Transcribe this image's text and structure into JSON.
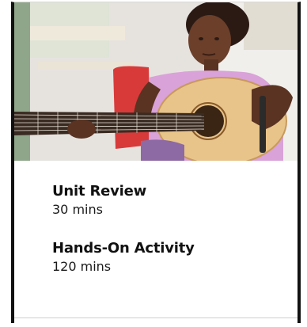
{
  "card": {
    "image": {
      "description_icon": "photo-girl-playing-guitar"
    },
    "items": [
      {
        "title": "Unit Review",
        "duration": "30 mins"
      },
      {
        "title": "Hands-On Activity",
        "duration": "120 mins"
      }
    ]
  },
  "colors": {
    "text": "#111111",
    "border": "#111111",
    "guitar": "#e8c48a",
    "shirt": "#d9a2d8",
    "chair": "#d83a3a"
  }
}
